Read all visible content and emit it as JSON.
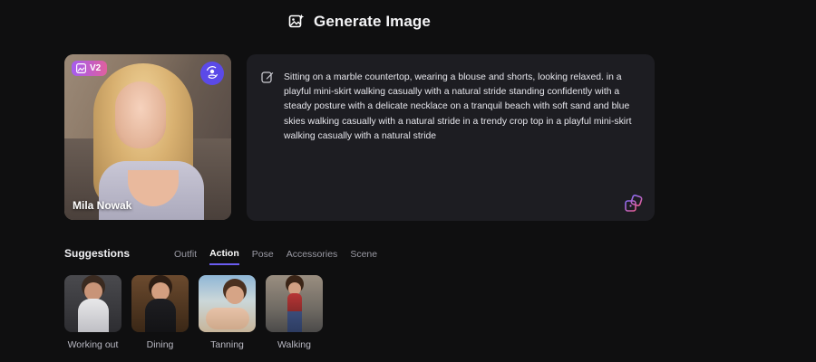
{
  "header": {
    "title": "Generate Image",
    "icon": "image-sparkle-icon"
  },
  "character": {
    "name": "Mila Nowak",
    "badge": "V2",
    "badge_icon": "image-icon",
    "swap_icon": "swap-face-icon"
  },
  "prompt": {
    "text": "Sitting on a marble countertop, wearing a blouse and shorts, looking relaxed. in a playful mini-skirt walking casually with a natural stride standing confidently with a steady posture with a delicate necklace on a tranquil beach with soft sand and blue skies walking casually with a natural stride in a trendy crop top in a playful mini-skirt walking casually with a natural stride",
    "edit_icon": "edit-icon",
    "random_icon": "dice-icon"
  },
  "suggestions": {
    "title": "Suggestions",
    "tabs": [
      {
        "label": "Outfit",
        "active": false
      },
      {
        "label": "Action",
        "active": true
      },
      {
        "label": "Pose",
        "active": false
      },
      {
        "label": "Accessories",
        "active": false
      },
      {
        "label": "Scene",
        "active": false
      }
    ],
    "items": [
      {
        "label": "Working out"
      },
      {
        "label": "Dining"
      },
      {
        "label": "Tanning"
      },
      {
        "label": "Walking"
      }
    ]
  },
  "colors": {
    "background": "#0f0f10",
    "panel": "#1d1d22",
    "accent": "#5b4ae8",
    "badge_gradient_start": "#a55cf0",
    "badge_gradient_end": "#e0609e"
  }
}
